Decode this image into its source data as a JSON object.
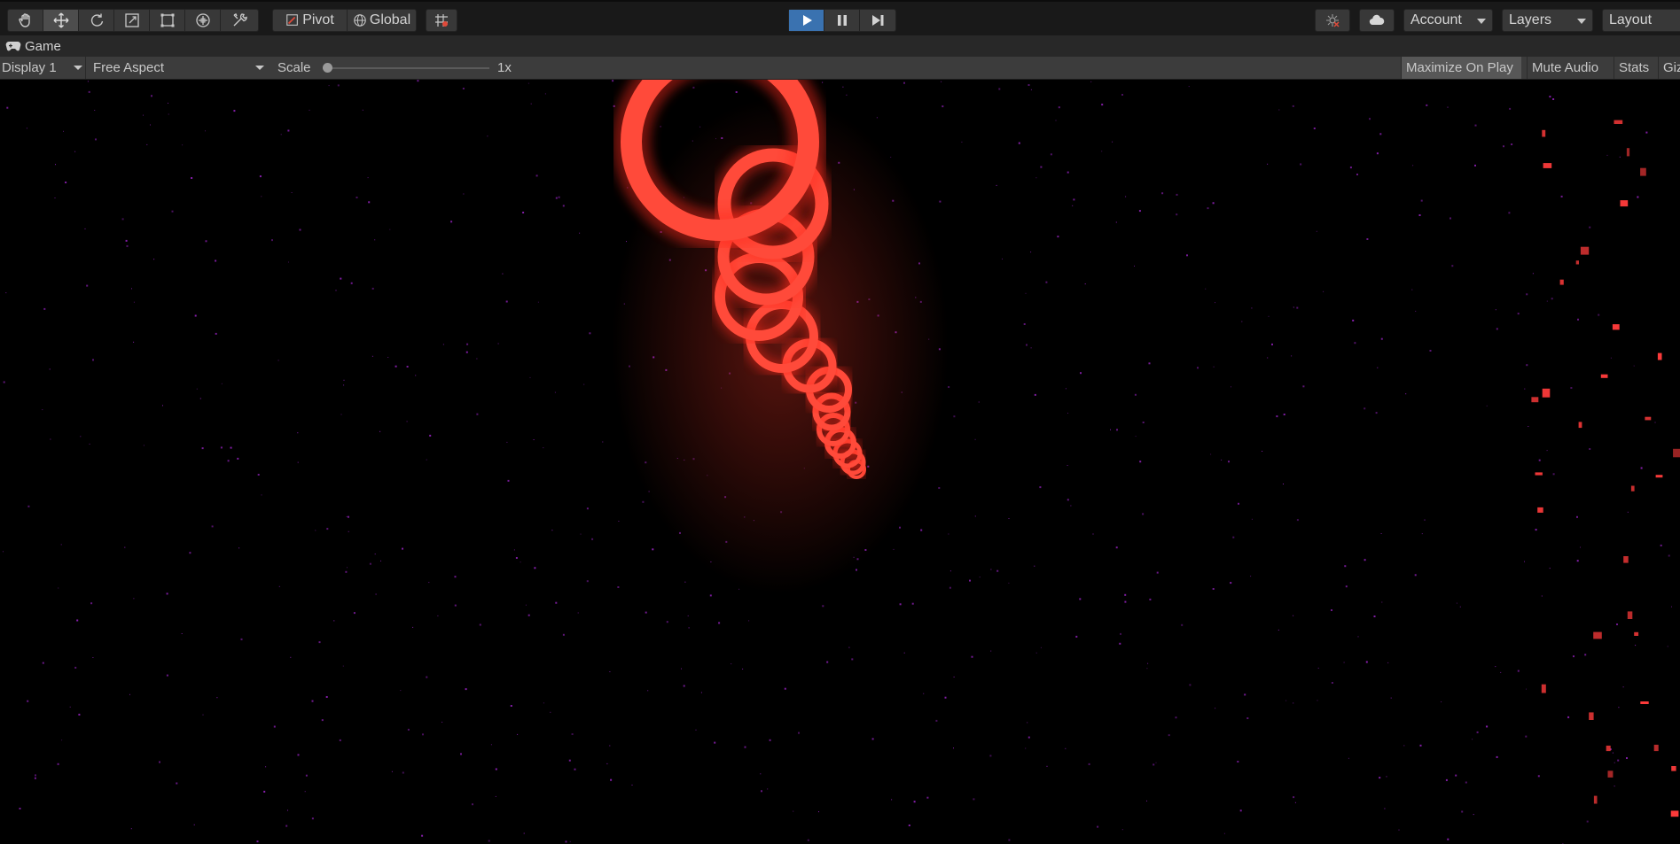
{
  "toolbar": {
    "tools": [
      "hand-tool-icon",
      "move-tool-icon",
      "rotate-tool-icon",
      "scale-tool-icon",
      "rect-tool-icon",
      "transform-tool-icon",
      "custom-tool-icon"
    ],
    "active_tool": "move-tool-icon",
    "pivot_label": "Pivot",
    "global_label": "Global",
    "snap_icon": "grid-snap-icon",
    "play_controls": [
      "play-icon",
      "pause-icon",
      "step-icon"
    ],
    "right": {
      "collab_icon": "collab-icon",
      "cloud_icon": "cloud-icon",
      "account_label": "Account",
      "layers_label": "Layers",
      "layout_label": "Layout"
    }
  },
  "tab": {
    "label": "Game",
    "icon": "gamepad-icon"
  },
  "game_toolbar": {
    "display_label": "Display 1",
    "aspect_label": "Free Aspect",
    "scale_label": "Scale",
    "scale_value_label": "1x",
    "scale_value": 0,
    "toggles": {
      "maximize_label": "Maximize On Play",
      "mute_label": "Mute Audio",
      "stats_label": "Stats",
      "gizmos_label": "Giz"
    },
    "maximize_on": true
  },
  "colors": {
    "play_active": "#3a72b0",
    "ring": "#ff4a3a",
    "star": "#8a1fb0",
    "spark": "#ff3b3b",
    "background": "#000000"
  }
}
